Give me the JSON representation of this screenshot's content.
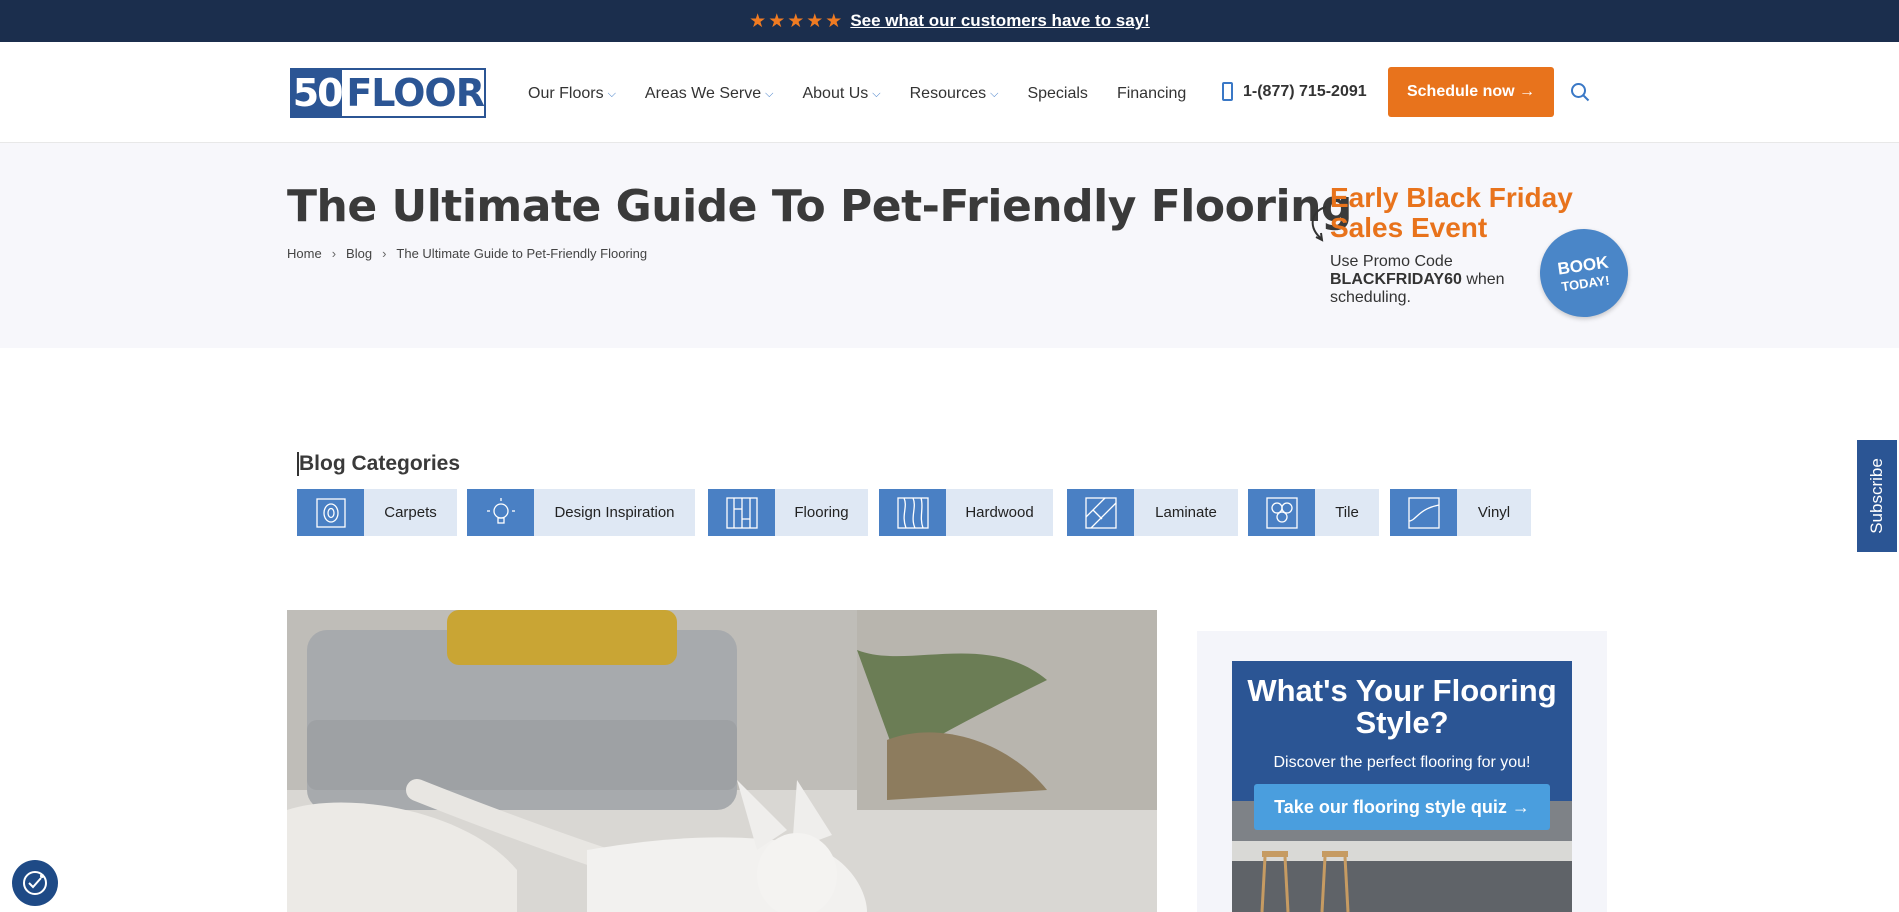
{
  "topbar": {
    "stars": "★★★★★",
    "link_text": "See what our customers have to say!"
  },
  "header": {
    "logo_number": "50",
    "logo_word": "FLOOR",
    "nav": [
      {
        "label": "Our Floors",
        "has_dropdown": true
      },
      {
        "label": "Areas We Serve",
        "has_dropdown": true
      },
      {
        "label": "About Us",
        "has_dropdown": true
      },
      {
        "label": "Resources",
        "has_dropdown": true
      },
      {
        "label": "Specials",
        "has_dropdown": false
      },
      {
        "label": "Financing",
        "has_dropdown": false
      }
    ],
    "phone": "1-(877) 715-2091",
    "schedule_label": "Schedule now →",
    "search_icon": "search-icon"
  },
  "hero": {
    "title": "The Ultimate Guide To Pet-Friendly Flooring",
    "breadcrumb": [
      "Home",
      "Blog",
      "The Ultimate Guide to Pet-Friendly Flooring"
    ],
    "promo_title": "Early Black Friday Sales Event",
    "promo_text_prefix": "Use Promo Code",
    "promo_code": "BLACKFRIDAY60",
    "promo_text_suffix": "when scheduling.",
    "badge_line1": "BOOK",
    "badge_line2": "TODAY!"
  },
  "blog": {
    "categories_title": "Blog Categories",
    "categories": [
      {
        "label": "Carpets",
        "icon": "carpet-roll-icon"
      },
      {
        "label": "Design Inspiration",
        "icon": "lightbulb-icon"
      },
      {
        "label": "Flooring",
        "icon": "planks-icon"
      },
      {
        "label": "Hardwood",
        "icon": "wood-grain-icon"
      },
      {
        "label": "Laminate",
        "icon": "laminate-icon"
      },
      {
        "label": "Tile",
        "icon": "hexagon-tile-icon"
      },
      {
        "label": "Vinyl",
        "icon": "vinyl-icon"
      }
    ]
  },
  "subscribe": {
    "label": "Subscribe"
  },
  "sidebar": {
    "quiz_title": "What's Your Flooring Style?",
    "quiz_sub": "Discover the perfect flooring for you!",
    "quiz_button": "Take our flooring style quiz →"
  },
  "colors": {
    "navy": "#1b2e4d",
    "brand_blue": "#2b5594",
    "accent_orange": "#e8731c",
    "category_blue": "#4a80c4",
    "category_bg": "#dfe8f4"
  }
}
